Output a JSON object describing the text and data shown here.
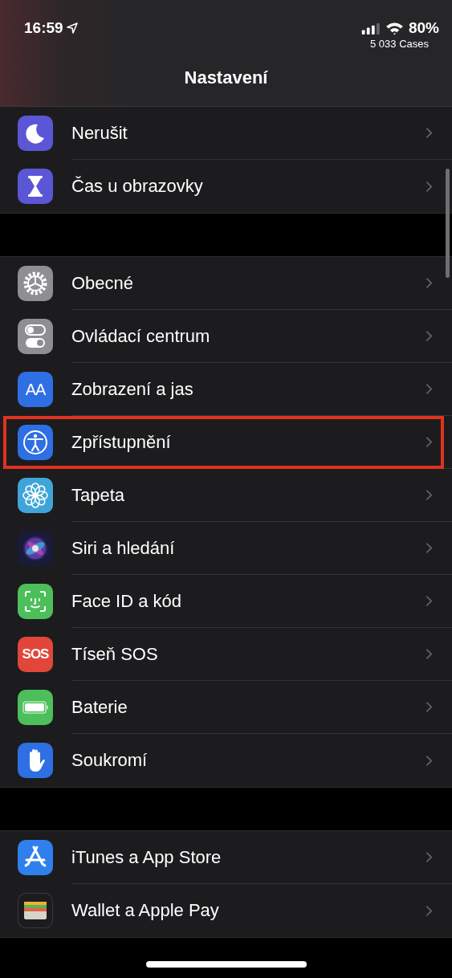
{
  "status_bar": {
    "time": "16:59",
    "battery": "80%",
    "carrier_note": "5 033 Cases"
  },
  "header": {
    "title": "Nastavení"
  },
  "groups": [
    {
      "rows": [
        {
          "label": "Nerušit",
          "kind": "moon",
          "color": "#5b56d6",
          "highlighted": false
        },
        {
          "label": "Čas u obrazovky",
          "kind": "hourglass",
          "color": "#5b56d6",
          "highlighted": false
        }
      ]
    },
    {
      "rows": [
        {
          "label": "Obecné",
          "kind": "gear",
          "color": "#8e8e93",
          "highlighted": false
        },
        {
          "label": "Ovládací centrum",
          "kind": "toggles",
          "color": "#8e8e93",
          "highlighted": false
        },
        {
          "label": "Zobrazení a jas",
          "kind": "glyph",
          "icon_text": "AA",
          "color": "#2f6fe4",
          "highlighted": false
        },
        {
          "label": "Zpřístupnění",
          "kind": "accessibility",
          "color": "#2f6fe4",
          "highlighted": true
        },
        {
          "label": "Tapeta",
          "kind": "flower",
          "color": "#3fa5d8",
          "highlighted": false
        },
        {
          "label": "Siri a hledání",
          "kind": "siri",
          "color": "#1a1a3a",
          "highlighted": false
        },
        {
          "label": "Face ID a kód",
          "kind": "face",
          "color": "#4cbf5a",
          "highlighted": false
        },
        {
          "label": "Tíseň SOS",
          "kind": "glyph",
          "icon_text": "SOS",
          "color": "#e2463a",
          "highlighted": false
        },
        {
          "label": "Baterie",
          "kind": "battery",
          "color": "#4cbf5a",
          "highlighted": false
        },
        {
          "label": "Soukromí",
          "kind": "hand",
          "color": "#2f6fe4",
          "highlighted": false
        }
      ]
    },
    {
      "rows": [
        {
          "label": "iTunes a App Store",
          "kind": "appstore",
          "color": "#2f80ed",
          "highlighted": false
        },
        {
          "label": "Wallet a Apple Pay",
          "kind": "wallet",
          "color": "#1c1c1e",
          "highlighted": false
        }
      ]
    }
  ]
}
